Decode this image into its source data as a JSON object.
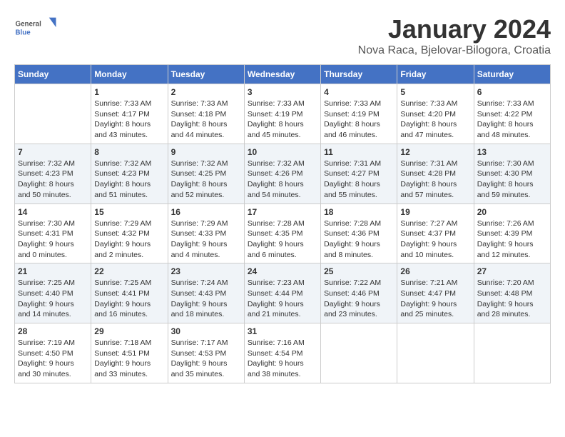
{
  "header": {
    "logo_line1": "General",
    "logo_line2": "Blue",
    "title": "January 2024",
    "subtitle": "Nova Raca, Bjelovar-Bilogora, Croatia"
  },
  "weekdays": [
    "Sunday",
    "Monday",
    "Tuesday",
    "Wednesday",
    "Thursday",
    "Friday",
    "Saturday"
  ],
  "weeks": [
    [
      {
        "day": "",
        "info": ""
      },
      {
        "day": "1",
        "info": "Sunrise: 7:33 AM\nSunset: 4:17 PM\nDaylight: 8 hours\nand 43 minutes."
      },
      {
        "day": "2",
        "info": "Sunrise: 7:33 AM\nSunset: 4:18 PM\nDaylight: 8 hours\nand 44 minutes."
      },
      {
        "day": "3",
        "info": "Sunrise: 7:33 AM\nSunset: 4:19 PM\nDaylight: 8 hours\nand 45 minutes."
      },
      {
        "day": "4",
        "info": "Sunrise: 7:33 AM\nSunset: 4:19 PM\nDaylight: 8 hours\nand 46 minutes."
      },
      {
        "day": "5",
        "info": "Sunrise: 7:33 AM\nSunset: 4:20 PM\nDaylight: 8 hours\nand 47 minutes."
      },
      {
        "day": "6",
        "info": "Sunrise: 7:33 AM\nSunset: 4:22 PM\nDaylight: 8 hours\nand 48 minutes."
      }
    ],
    [
      {
        "day": "7",
        "info": "Sunrise: 7:32 AM\nSunset: 4:23 PM\nDaylight: 8 hours\nand 50 minutes."
      },
      {
        "day": "8",
        "info": "Sunrise: 7:32 AM\nSunset: 4:23 PM\nDaylight: 8 hours\nand 51 minutes."
      },
      {
        "day": "9",
        "info": "Sunrise: 7:32 AM\nSunset: 4:25 PM\nDaylight: 8 hours\nand 52 minutes."
      },
      {
        "day": "10",
        "info": "Sunrise: 7:32 AM\nSunset: 4:26 PM\nDaylight: 8 hours\nand 54 minutes."
      },
      {
        "day": "11",
        "info": "Sunrise: 7:31 AM\nSunset: 4:27 PM\nDaylight: 8 hours\nand 55 minutes."
      },
      {
        "day": "12",
        "info": "Sunrise: 7:31 AM\nSunset: 4:28 PM\nDaylight: 8 hours\nand 57 minutes."
      },
      {
        "day": "13",
        "info": "Sunrise: 7:30 AM\nSunset: 4:30 PM\nDaylight: 8 hours\nand 59 minutes."
      }
    ],
    [
      {
        "day": "14",
        "info": "Sunrise: 7:30 AM\nSunset: 4:31 PM\nDaylight: 9 hours\nand 0 minutes."
      },
      {
        "day": "15",
        "info": "Sunrise: 7:29 AM\nSunset: 4:32 PM\nDaylight: 9 hours\nand 2 minutes."
      },
      {
        "day": "16",
        "info": "Sunrise: 7:29 AM\nSunset: 4:33 PM\nDaylight: 9 hours\nand 4 minutes."
      },
      {
        "day": "17",
        "info": "Sunrise: 7:28 AM\nSunset: 4:35 PM\nDaylight: 9 hours\nand 6 minutes."
      },
      {
        "day": "18",
        "info": "Sunrise: 7:28 AM\nSunset: 4:36 PM\nDaylight: 9 hours\nand 8 minutes."
      },
      {
        "day": "19",
        "info": "Sunrise: 7:27 AM\nSunset: 4:37 PM\nDaylight: 9 hours\nand 10 minutes."
      },
      {
        "day": "20",
        "info": "Sunrise: 7:26 AM\nSunset: 4:39 PM\nDaylight: 9 hours\nand 12 minutes."
      }
    ],
    [
      {
        "day": "21",
        "info": "Sunrise: 7:25 AM\nSunset: 4:40 PM\nDaylight: 9 hours\nand 14 minutes."
      },
      {
        "day": "22",
        "info": "Sunrise: 7:25 AM\nSunset: 4:41 PM\nDaylight: 9 hours\nand 16 minutes."
      },
      {
        "day": "23",
        "info": "Sunrise: 7:24 AM\nSunset: 4:43 PM\nDaylight: 9 hours\nand 18 minutes."
      },
      {
        "day": "24",
        "info": "Sunrise: 7:23 AM\nSunset: 4:44 PM\nDaylight: 9 hours\nand 21 minutes."
      },
      {
        "day": "25",
        "info": "Sunrise: 7:22 AM\nSunset: 4:46 PM\nDaylight: 9 hours\nand 23 minutes."
      },
      {
        "day": "26",
        "info": "Sunrise: 7:21 AM\nSunset: 4:47 PM\nDaylight: 9 hours\nand 25 minutes."
      },
      {
        "day": "27",
        "info": "Sunrise: 7:20 AM\nSunset: 4:48 PM\nDaylight: 9 hours\nand 28 minutes."
      }
    ],
    [
      {
        "day": "28",
        "info": "Sunrise: 7:19 AM\nSunset: 4:50 PM\nDaylight: 9 hours\nand 30 minutes."
      },
      {
        "day": "29",
        "info": "Sunrise: 7:18 AM\nSunset: 4:51 PM\nDaylight: 9 hours\nand 33 minutes."
      },
      {
        "day": "30",
        "info": "Sunrise: 7:17 AM\nSunset: 4:53 PM\nDaylight: 9 hours\nand 35 minutes."
      },
      {
        "day": "31",
        "info": "Sunrise: 7:16 AM\nSunset: 4:54 PM\nDaylight: 9 hours\nand 38 minutes."
      },
      {
        "day": "",
        "info": ""
      },
      {
        "day": "",
        "info": ""
      },
      {
        "day": "",
        "info": ""
      }
    ]
  ]
}
